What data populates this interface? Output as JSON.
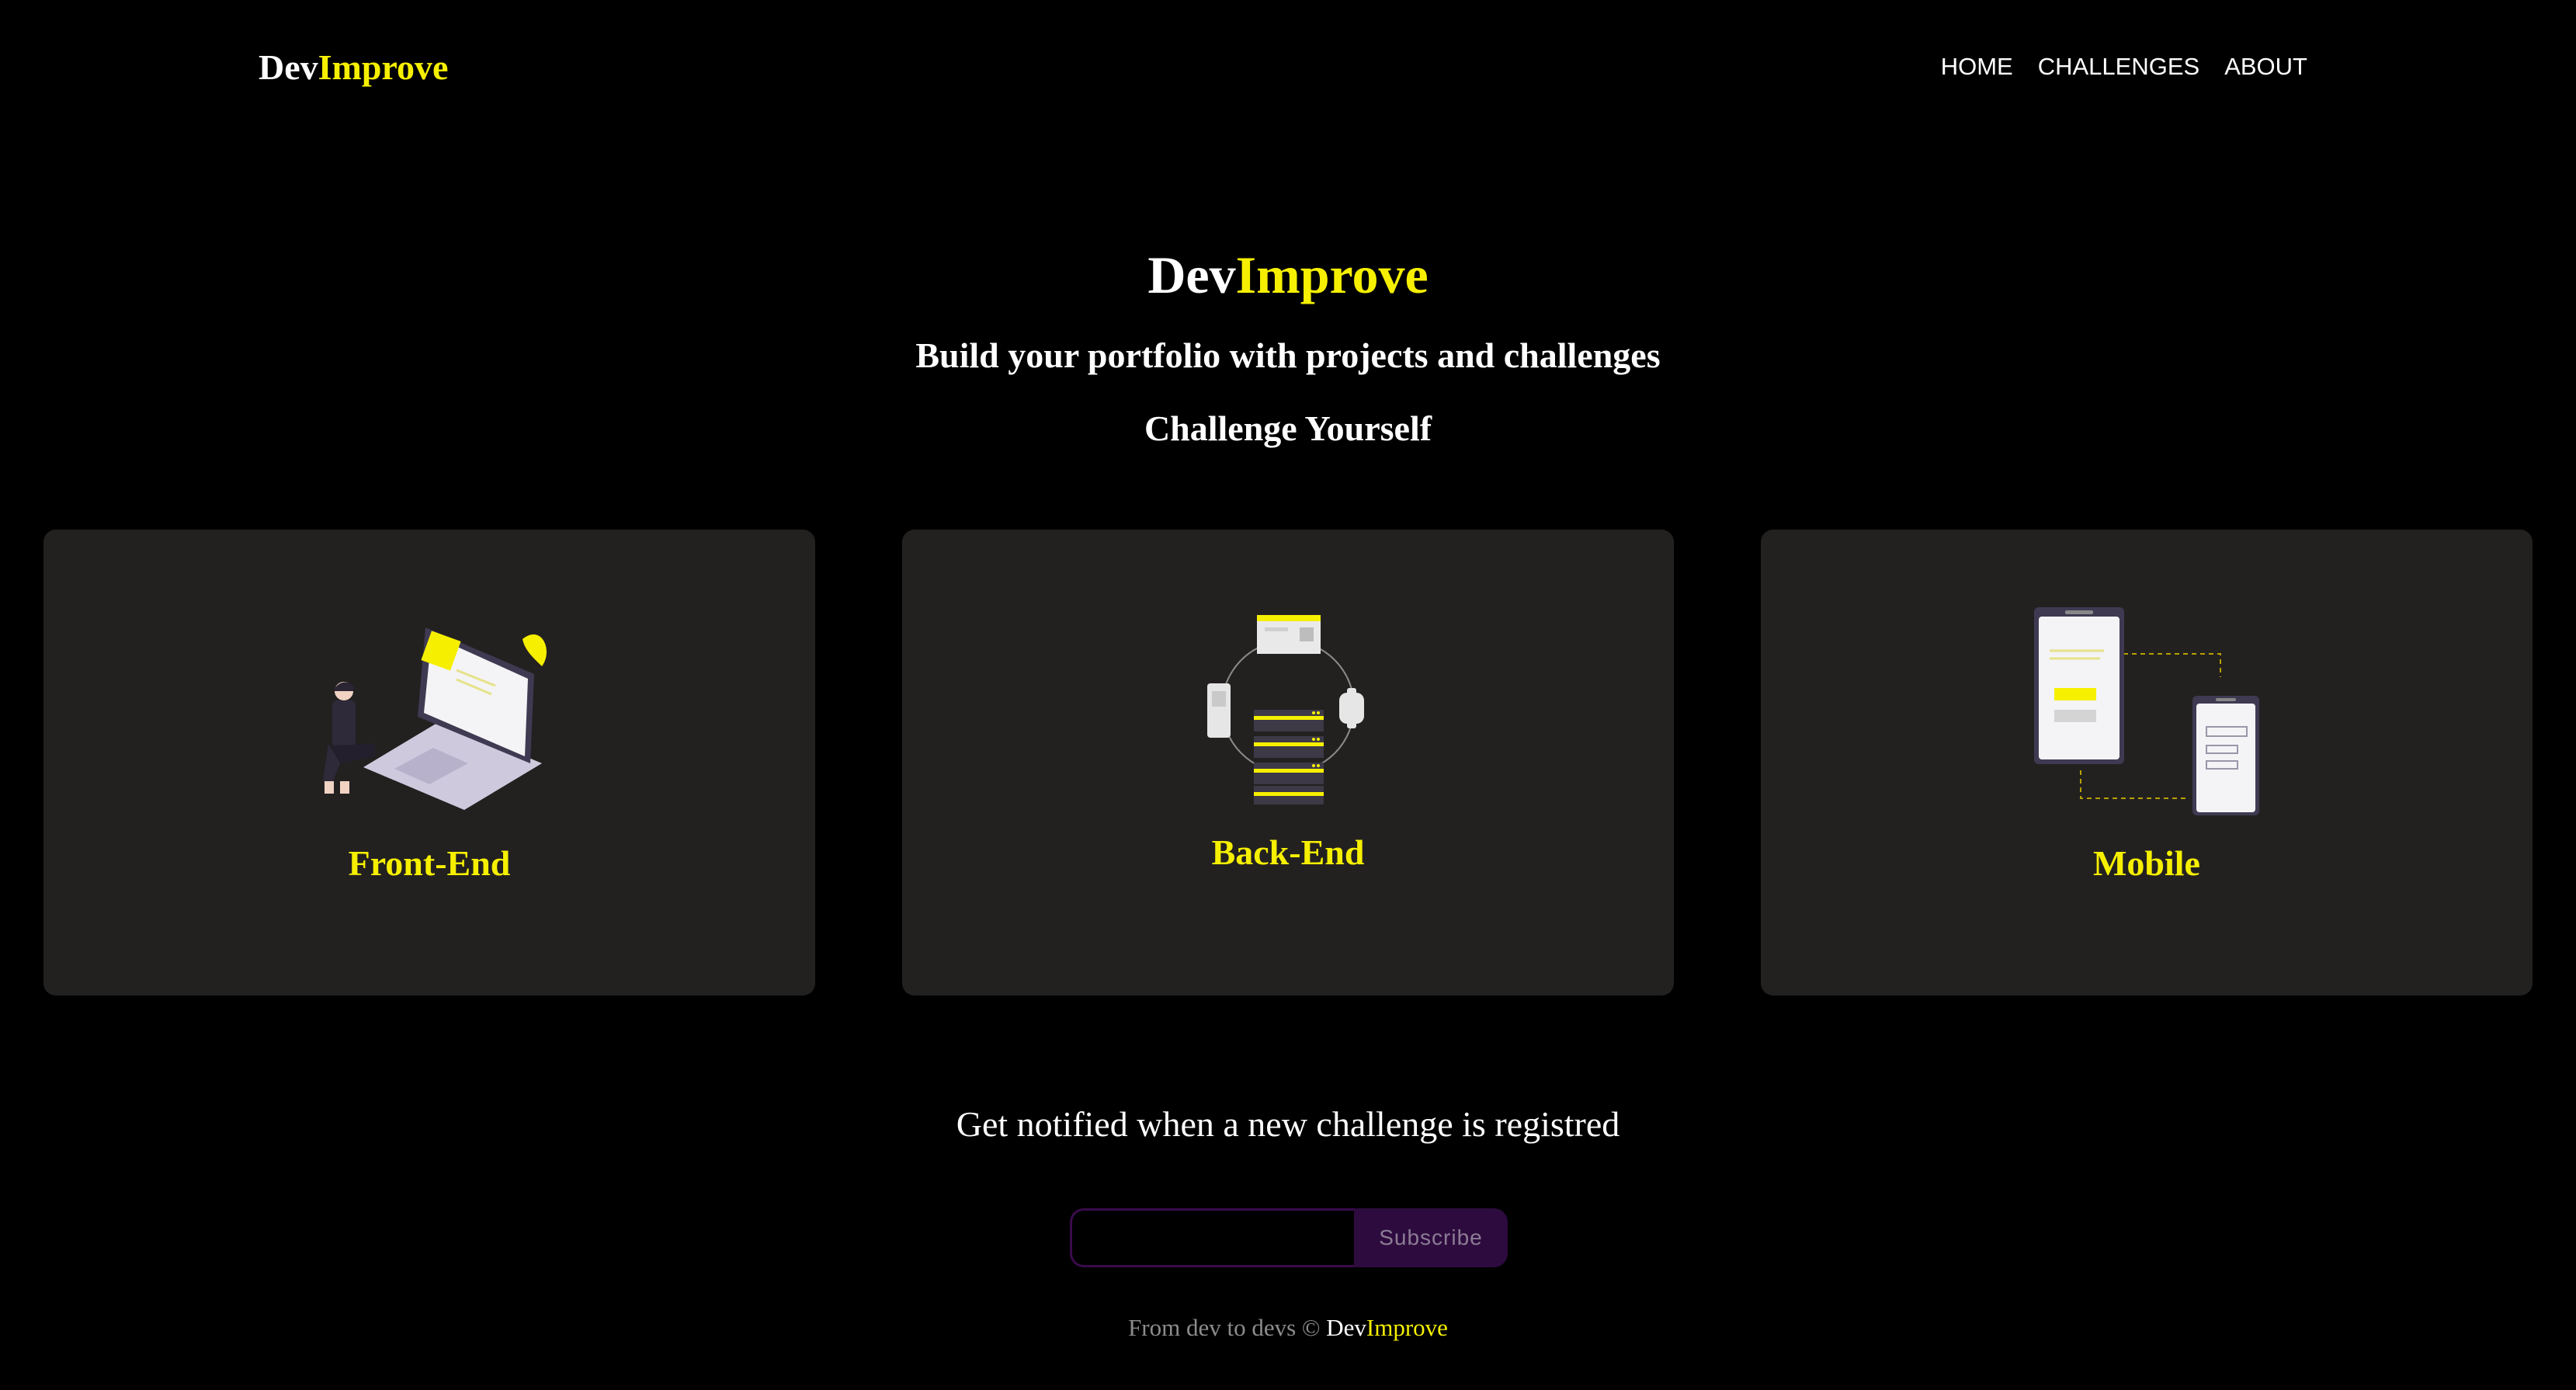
{
  "header": {
    "brand_part1": "Dev",
    "brand_part2": "Improve",
    "nav": [
      {
        "label": "HOME"
      },
      {
        "label": "CHALLENGES"
      },
      {
        "label": "ABOUT"
      }
    ]
  },
  "hero": {
    "title_part1": "Dev",
    "title_part2": "Improve",
    "subtitle": "Build your portfolio with projects and challenges",
    "cta": "Challenge Yourself"
  },
  "cards": [
    {
      "label": "Front-End",
      "icon": "laptop-person-illustration"
    },
    {
      "label": "Back-End",
      "icon": "server-network-illustration"
    },
    {
      "label": "Mobile",
      "icon": "phones-illustration"
    }
  ],
  "notify": {
    "text": "Get notified when a new challenge is registred",
    "email_placeholder": "",
    "button_label": "Subscribe"
  },
  "footer": {
    "prefix": "From dev to devs © ",
    "brand_part1": "Dev",
    "brand_part2": "Improve"
  },
  "colors": {
    "accent": "#f6f000",
    "background": "#000000",
    "card": "#232120",
    "subscribe_bg": "#2e0b3f"
  }
}
